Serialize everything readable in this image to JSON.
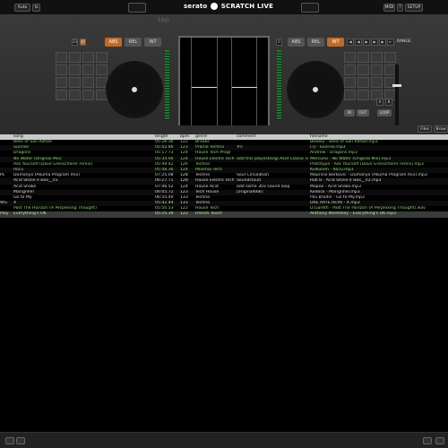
{
  "topbar": {
    "auto_label": "Auto",
    "logo_serato": "serato",
    "logo_product": "SCRATCH LIVE",
    "midi_label": "MIDI",
    "setup_label": "SETUP"
  },
  "decks": {
    "tap_label": "tap",
    "left": {
      "value_a": "33",
      "value_b": "45",
      "abs": "ABS",
      "rel": "REL",
      "int": "INT",
      "active_mode": "ABS"
    },
    "right": {
      "value_a": "0",
      "abs": "ABS",
      "rel": "REL",
      "int": "INT",
      "active_mode": "INT",
      "range_label": "RANGE",
      "in_label": "IN",
      "out_label": "OUT",
      "loop_label": "LOOP",
      "a_label": "A",
      "b_label": "B"
    }
  },
  "library_tools": {
    "files_label": "Files",
    "browse_label": "Brow"
  },
  "columns": [
    "song",
    "length",
    "bpm",
    "genre",
    "comment",
    "filename"
  ],
  "rows": [
    {
      "lead": "",
      "song": "Bells of San Rafael",
      "length": "05:26.36",
      "bpm": "122",
      "genre": "Breaks",
      "comment": "",
      "filename": "Bewley - Bells of San Rafael.mp3",
      "state": "normal"
    },
    {
      "lead": "",
      "song": "Sunrise",
      "length": "05:42.86",
      "bpm": "123",
      "genre": "Prairie Techno",
      "comment": "#5",
      "filename": "LTJ - Sunrise.mp3",
      "state": "normal"
    },
    {
      "lead": "",
      "song": "Dragons",
      "length": "05:17.73",
      "bpm": "124",
      "genre": "House Tech Progr",
      "comment": "",
      "filename": "Andrew - Dragons.mp3",
      "state": "normal"
    },
    {
      "lead": "",
      "song": "No Water (Original Mix)",
      "length": "05:34.94",
      "bpm": "124",
      "genre": "House Electro Tech",
      "comment": "add this playlist/Digi Acid Classic sounds",
      "filename": "Mercurio - No Water (Original Mix).mp3",
      "state": "normal"
    },
    {
      "lead": "",
      "song": "Ask Yourself (Dave Gresscherer remix)",
      "length": "05:49.42",
      "bpm": "126",
      "genre": "Techno",
      "comment": "",
      "filename": "Prototype - Ask Yourself (Dave Gresscherer remix).mp3",
      "state": "normal"
    },
    {
      "lead": "",
      "song": "Rocu",
      "length": "05:48.36",
      "bpm": "124",
      "genre": "Minimal Tech",
      "comment": "",
      "filename": "Kolkunen - Rocu.mp3",
      "state": "normal"
    },
    {
      "lead": "PL",
      "song": "Dumanyo (Akuma Program mix)",
      "length": "07:25.08",
      "bpm": "128",
      "genre": "Techno",
      "comment": "Soul Circulation",
      "filename": "Mauricio Borkovic - Dumanyo (Akuma Program mix).mp3",
      "state": "played"
    },
    {
      "lead": "",
      "song": "Acid Stone II was__V2",
      "length": "06:27.71",
      "bpm": "128",
      "genre": "House Electro Tech",
      "comment": "Soundcloud",
      "filename": "Rob B - Acid Stone II was__V2.mp3",
      "state": "played"
    },
    {
      "lead": "",
      "song": "Acid Shake",
      "length": "07:46.52",
      "bpm": "124",
      "genre": "House Acid",
      "comment": "add some 303 sound loop",
      "filename": "Mopoo - Acid Shake.mp3",
      "state": "played"
    },
    {
      "lead": "",
      "song": "Marignhel",
      "length": "06:05.72",
      "bpm": "123",
      "genre": "Tech House",
      "comment": "[original666]",
      "filename": "Kedock - Marignhel.mp3",
      "state": "played"
    },
    {
      "lead": "",
      "song": "Go to My",
      "length": "06:55.40",
      "bpm": "133",
      "genre": "Techno",
      "comment": "",
      "filename": "Psu Brudin - Go to My.mp3",
      "state": "played"
    },
    {
      "lead": "WG",
      "song": "X",
      "length": "05:42.44",
      "bpm": "133",
      "genre": "Techno",
      "comment": "",
      "filename": "DRE RATE REV6 - X.mp3",
      "state": "played"
    },
    {
      "lead": "",
      "song": "Past The Horizon (A Perplexing Thought)",
      "length": "05:50.53",
      "bpm": "122",
      "genre": "House Tech",
      "comment": "",
      "filename": "D.Gareth - Past The Horizon (A Perplexing Thought).wav",
      "state": "normal"
    },
    {
      "lead": "Play",
      "song": "Everything's OK",
      "length": "05:25.39",
      "bpm": "122",
      "genre": "French Touch",
      "comment": "",
      "filename": "Anthony Montelley - Everything's OK.mp3",
      "state": "selected"
    }
  ],
  "colors": {
    "accent_orange": "#c06a26",
    "track_green": "#8fd37a",
    "played_text": "#d8d8d8",
    "header_bg": "#c9c9c9"
  }
}
